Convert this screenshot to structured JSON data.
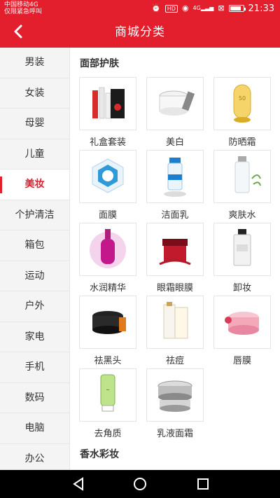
{
  "status_bar": {
    "carrier_line1": "中国移动4G",
    "carrier_line2": "仅限紧急呼叫",
    "network": "4G",
    "hd": "HD",
    "time": "21:33",
    "battery_level": 0.85
  },
  "header": {
    "back_icon": "back-arrow-icon",
    "title": "商城分类"
  },
  "sidebar": {
    "items": [
      {
        "label": "男装"
      },
      {
        "label": "女装"
      },
      {
        "label": "母婴"
      },
      {
        "label": "儿童"
      },
      {
        "label": "美妆",
        "active": true
      },
      {
        "label": "个护清洁"
      },
      {
        "label": "箱包"
      },
      {
        "label": "运动"
      },
      {
        "label": "户外"
      },
      {
        "label": "家电"
      },
      {
        "label": "手机"
      },
      {
        "label": "数码"
      },
      {
        "label": "电脑"
      },
      {
        "label": "办公"
      }
    ]
  },
  "content": {
    "section1_title": "面部护肤",
    "section2_title": "香水彩妆",
    "tiles": [
      {
        "label": "礼盒套装",
        "icon": "gift-set-icon"
      },
      {
        "label": "美白",
        "icon": "whitening-cream-icon"
      },
      {
        "label": "防晒霜",
        "icon": "sunscreen-icon"
      },
      {
        "label": "面膜",
        "icon": "face-mask-icon"
      },
      {
        "label": "洁面乳",
        "icon": "cleanser-icon"
      },
      {
        "label": "爽肤水",
        "icon": "toner-icon"
      },
      {
        "label": "水润精华",
        "icon": "serum-icon"
      },
      {
        "label": "眼霜眼膜",
        "icon": "eye-cream-icon"
      },
      {
        "label": "卸妆",
        "icon": "makeup-remover-icon"
      },
      {
        "label": "祛黑头",
        "icon": "blackhead-remover-icon"
      },
      {
        "label": "祛痘",
        "icon": "acne-treatment-icon"
      },
      {
        "label": "唇膜",
        "icon": "lip-mask-icon"
      },
      {
        "label": "去角质",
        "icon": "exfoliator-icon"
      },
      {
        "label": "乳液面霜",
        "icon": "lotion-cream-icon"
      }
    ]
  },
  "nav_bar": {
    "back": "nav-back-icon",
    "home": "nav-home-icon",
    "recent": "nav-recent-icon"
  },
  "colors": {
    "accent": "#e31e2d"
  }
}
